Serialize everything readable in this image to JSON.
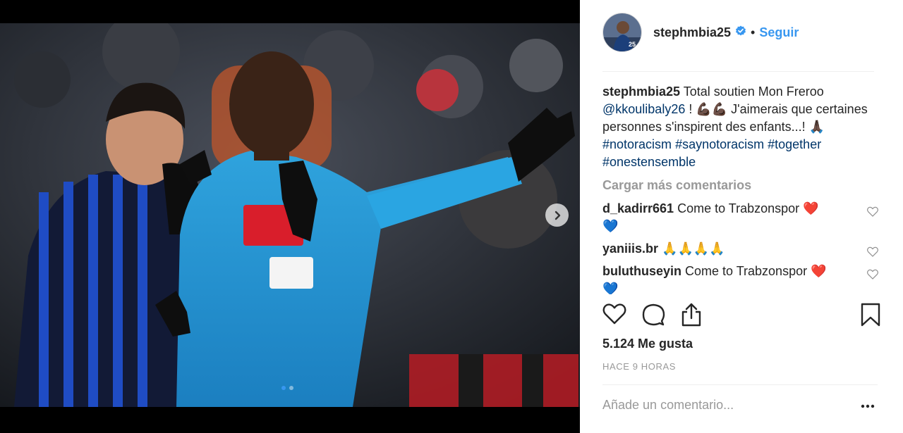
{
  "post": {
    "username": "stephmbia25",
    "separator": "•",
    "follow_label": "Seguir",
    "avatar_number": "25"
  },
  "caption": {
    "username": "stephmbia25",
    "text_1": " Total soutien Mon Freroo ",
    "mention": "@kkoulibaly26",
    "text_2": " ! 💪🏿💪🏿  J'aimerais que certaines personnes s'inspirent des enfants...! 🙏🏿 ",
    "hashtags": [
      "#notoracism",
      "#saynotoracism",
      "#together",
      "#onestensemble"
    ]
  },
  "load_more_label": "Cargar más comentarios",
  "comments": [
    {
      "username": "d_kadirr661",
      "text": " Come to Trabzonspor ",
      "emoji_1": "❤️",
      "emoji_2": "💙"
    },
    {
      "username": "yaniiis.br",
      "text": " 🙏🙏🙏🙏",
      "emoji_1": "",
      "emoji_2": ""
    },
    {
      "username": "buluthuseyin",
      "text": " Come to Trabzonspor ",
      "emoji_1": "❤️",
      "emoji_2": "💙"
    }
  ],
  "likes_label": "5.124 Me gusta",
  "time_label": "HACE 9 HORAS",
  "comment_input": {
    "placeholder": "Añade un comentario..."
  },
  "icons": {
    "like": "heart-outline-icon",
    "comment": "comment-bubble-icon",
    "share": "share-upload-icon",
    "save": "bookmark-icon",
    "more": "more-dots-icon",
    "next": "chevron-right-icon",
    "verified": "verified-badge-icon"
  },
  "colors": {
    "accent": "#3897f0",
    "hashtag": "#003569",
    "muted": "#999999",
    "heart": "#ed4956"
  },
  "carousel": {
    "slides": 2,
    "active": 1
  }
}
